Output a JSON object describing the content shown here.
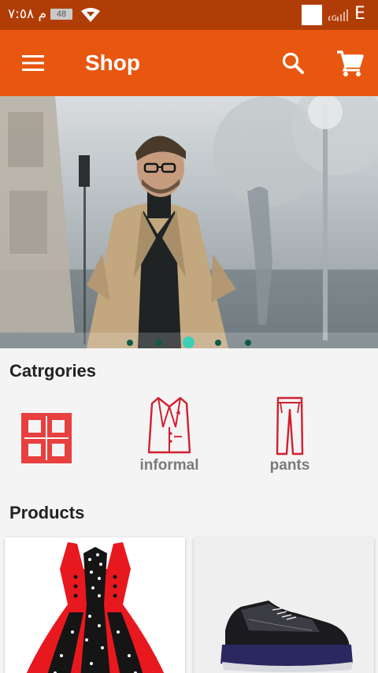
{
  "status_bar": {
    "time": "م ٧:٥٨",
    "battery": "48",
    "signal_label": "٤G",
    "network": "E"
  },
  "app_bar": {
    "title": "Shop"
  },
  "banner": {
    "slide_count": 5,
    "active_slide": 3
  },
  "categories": {
    "title": "Catrgories",
    "items": [
      {
        "label": "",
        "icon": "grid-icon"
      },
      {
        "label": "informal",
        "icon": "blazer-icon"
      },
      {
        "label": "pants",
        "icon": "pants-icon"
      }
    ]
  },
  "products": {
    "title": "Products",
    "items": [
      {
        "image": "red-polka-dot-dress"
      },
      {
        "image": "black-navy-sneaker"
      }
    ]
  },
  "colors": {
    "status_bar": "#b13d06",
    "app_bar": "#e8570f",
    "accent_red": "#e83f3f",
    "dot_active": "#3ad1b6"
  }
}
